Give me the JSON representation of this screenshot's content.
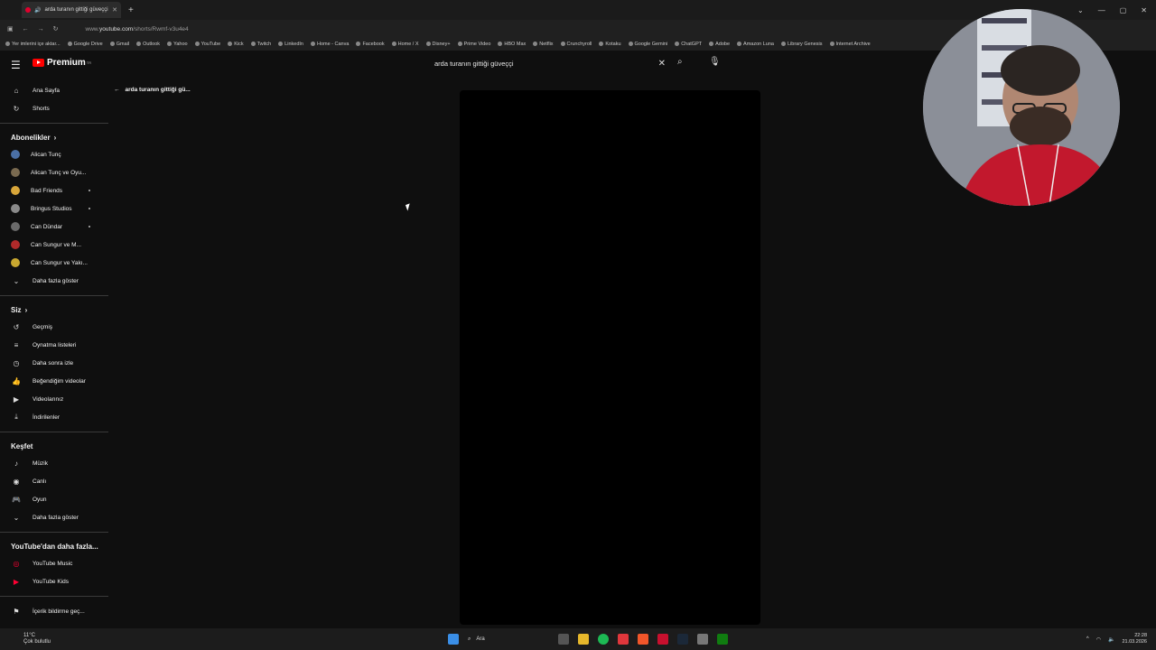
{
  "browser": {
    "tab_title": "arda turanın gittiği güveççi",
    "url_prefix": "www.",
    "url_domain": "youtube.com",
    "url_path": "/shorts/Rwmf-v3u4e4"
  },
  "bookmarks": [
    "Yer imlerini içe aktar...",
    "Google Drive",
    "Gmail",
    "Outlook",
    "Yahoo",
    "YouTube",
    "Kick",
    "Twitch",
    "LinkedIn",
    "Home - Canva",
    "Facebook",
    "Home / X",
    "Disney+",
    "Prime Video",
    "HBO Max",
    "Netflix",
    "Crunchyroll",
    "Kotaku",
    "Google Gemini",
    "ChatGPT",
    "Adobe",
    "Amazon Luna",
    "Library Genesis",
    "Internet Archive"
  ],
  "header": {
    "logo_text": "Premium",
    "logo_country": "TR",
    "search_value": "arda turanın gittiği güveççi"
  },
  "sidebar": {
    "top": [
      {
        "label": "Ana Sayfa",
        "icon": "home-icon"
      },
      {
        "label": "Shorts",
        "icon": "shorts-icon"
      }
    ],
    "subs_title": "Abonelikler",
    "subs": [
      {
        "label": "Alican Tunç",
        "color": "#4a6fa5"
      },
      {
        "label": "Alican Tunç ve Oyu...",
        "color": "#7a6a50"
      },
      {
        "label": "Bad Friends",
        "color": "#d8a63a"
      },
      {
        "label": "Bringus Studios",
        "color": "#8a8a8a"
      },
      {
        "label": "Can Dündar",
        "color": "#6a6a6a"
      },
      {
        "label": "Can Sungur ve M...",
        "color": "#b02a2a"
      },
      {
        "label": "Can Sungur ve Yakı...",
        "color": "#c9a830"
      }
    ],
    "subs_more": "Daha fazla göster",
    "you_title": "Siz",
    "you": [
      {
        "label": "Geçmiş",
        "icon": "history-icon"
      },
      {
        "label": "Oynatma listeleri",
        "icon": "playlist-icon"
      },
      {
        "label": "Daha sonra izle",
        "icon": "clock-icon"
      },
      {
        "label": "Beğendiğim videolar",
        "icon": "like-icon"
      },
      {
        "label": "Videolarınız",
        "icon": "video-icon"
      },
      {
        "label": "İndirilenler",
        "icon": "download-icon"
      }
    ],
    "explore_title": "Keşfet",
    "explore": [
      {
        "label": "Müzik",
        "icon": "music-icon"
      },
      {
        "label": "Canlı",
        "icon": "live-icon"
      },
      {
        "label": "Oyun",
        "icon": "gaming-icon"
      }
    ],
    "explore_more": "Daha fazla göster",
    "more_title": "YouTube'dan daha fazla...",
    "more": [
      {
        "label": "YouTube Music",
        "icon": "youtube-music-icon"
      },
      {
        "label": "YouTube Kids",
        "icon": "youtube-kids-icon"
      }
    ],
    "report": "İçerik bildirme geç..."
  },
  "main": {
    "back_label": "arda turanın gittiği gü..."
  },
  "taskbar": {
    "temp": "11°C",
    "weather": "Çok bulutlu",
    "search": "Ara",
    "time": "22:28",
    "date": "21.03.2026"
  }
}
